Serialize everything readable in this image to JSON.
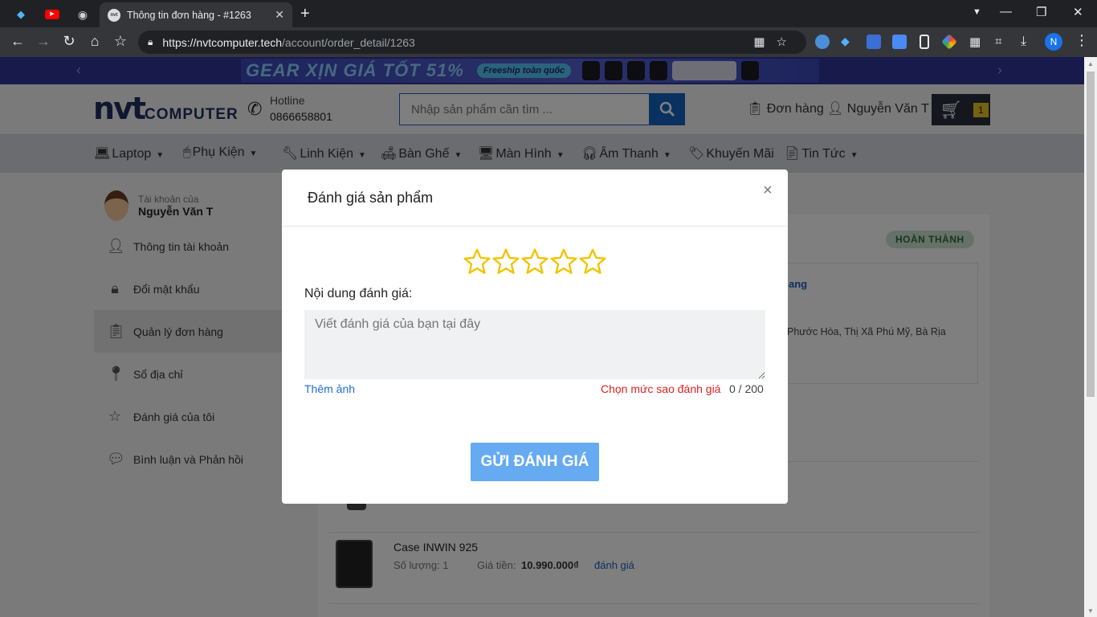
{
  "browser": {
    "tab_title": "Thông tin đơn hàng - #1263",
    "url_host": "https://nvtcomputer.tech",
    "url_path": "/account/order_detail/1263",
    "profile_initial": "N"
  },
  "banner": {
    "promo_text": "GEAR XỊN GIÁ TỐT 51%",
    "shipping": "Freeship toàn quốc"
  },
  "header": {
    "logo_main": "nvt",
    "logo_sub": "COMPUTER",
    "hotline_label": "Hotline",
    "hotline_number": "0866658801",
    "search_placeholder": "Nhập sản phẩm cần tìm ...",
    "orders_label": "Đơn hàng",
    "user_name": "Nguyễn Văn T",
    "cart_count": "1"
  },
  "nav": {
    "items": [
      {
        "label": "Laptop"
      },
      {
        "label": "Phụ Kiện"
      },
      {
        "label": "Linh Kiện"
      },
      {
        "label": "Bàn Ghế"
      },
      {
        "label": "Màn Hình"
      },
      {
        "label": "Âm Thanh"
      },
      {
        "label": "Khuyến Mãi"
      },
      {
        "label": "Tin Tức"
      }
    ]
  },
  "sidebar": {
    "account_label": "Tài khoản của",
    "account_name": "Nguyễn Văn T",
    "items": [
      {
        "label": "Thông tin tài khoản"
      },
      {
        "label": "Đổi mật khẩu"
      },
      {
        "label": "Quản lý đơn hàng"
      },
      {
        "label": "Sổ địa chỉ"
      },
      {
        "label": "Đánh giá của tôi"
      },
      {
        "label": "Bình luận và Phản hồi"
      }
    ]
  },
  "order": {
    "status": "HOÀN THÀNH",
    "address_link_fragment": "ang",
    "address_fragment": "Phước Hòa, Thị Xã Phú Mỹ, Bà Rịa",
    "product": {
      "name": "Case INWIN 925",
      "quantity": "Số lượng: 1",
      "price_label": "Giá tiền:",
      "price": "10.990.000₫",
      "review_link": "đánh giá"
    }
  },
  "modal": {
    "title": "Đánh giá sản phẩm",
    "close": "×",
    "star_rating": 0,
    "star_max": 5,
    "review_label": "Nội dung đánh giá:",
    "review_placeholder": "Viết đánh giá của bạn tại đây",
    "add_photo": "Thêm ảnh",
    "choose_star": "Chọn mức sao đánh giá",
    "char_count": "0 / 200",
    "submit": "GỬI ĐÁNH GIÁ"
  },
  "colors": {
    "primary": "#1565c0",
    "star": "#f2c400",
    "submit": "#66aaf2",
    "warning": "#e02020",
    "status_bg": "#cde3d2"
  }
}
